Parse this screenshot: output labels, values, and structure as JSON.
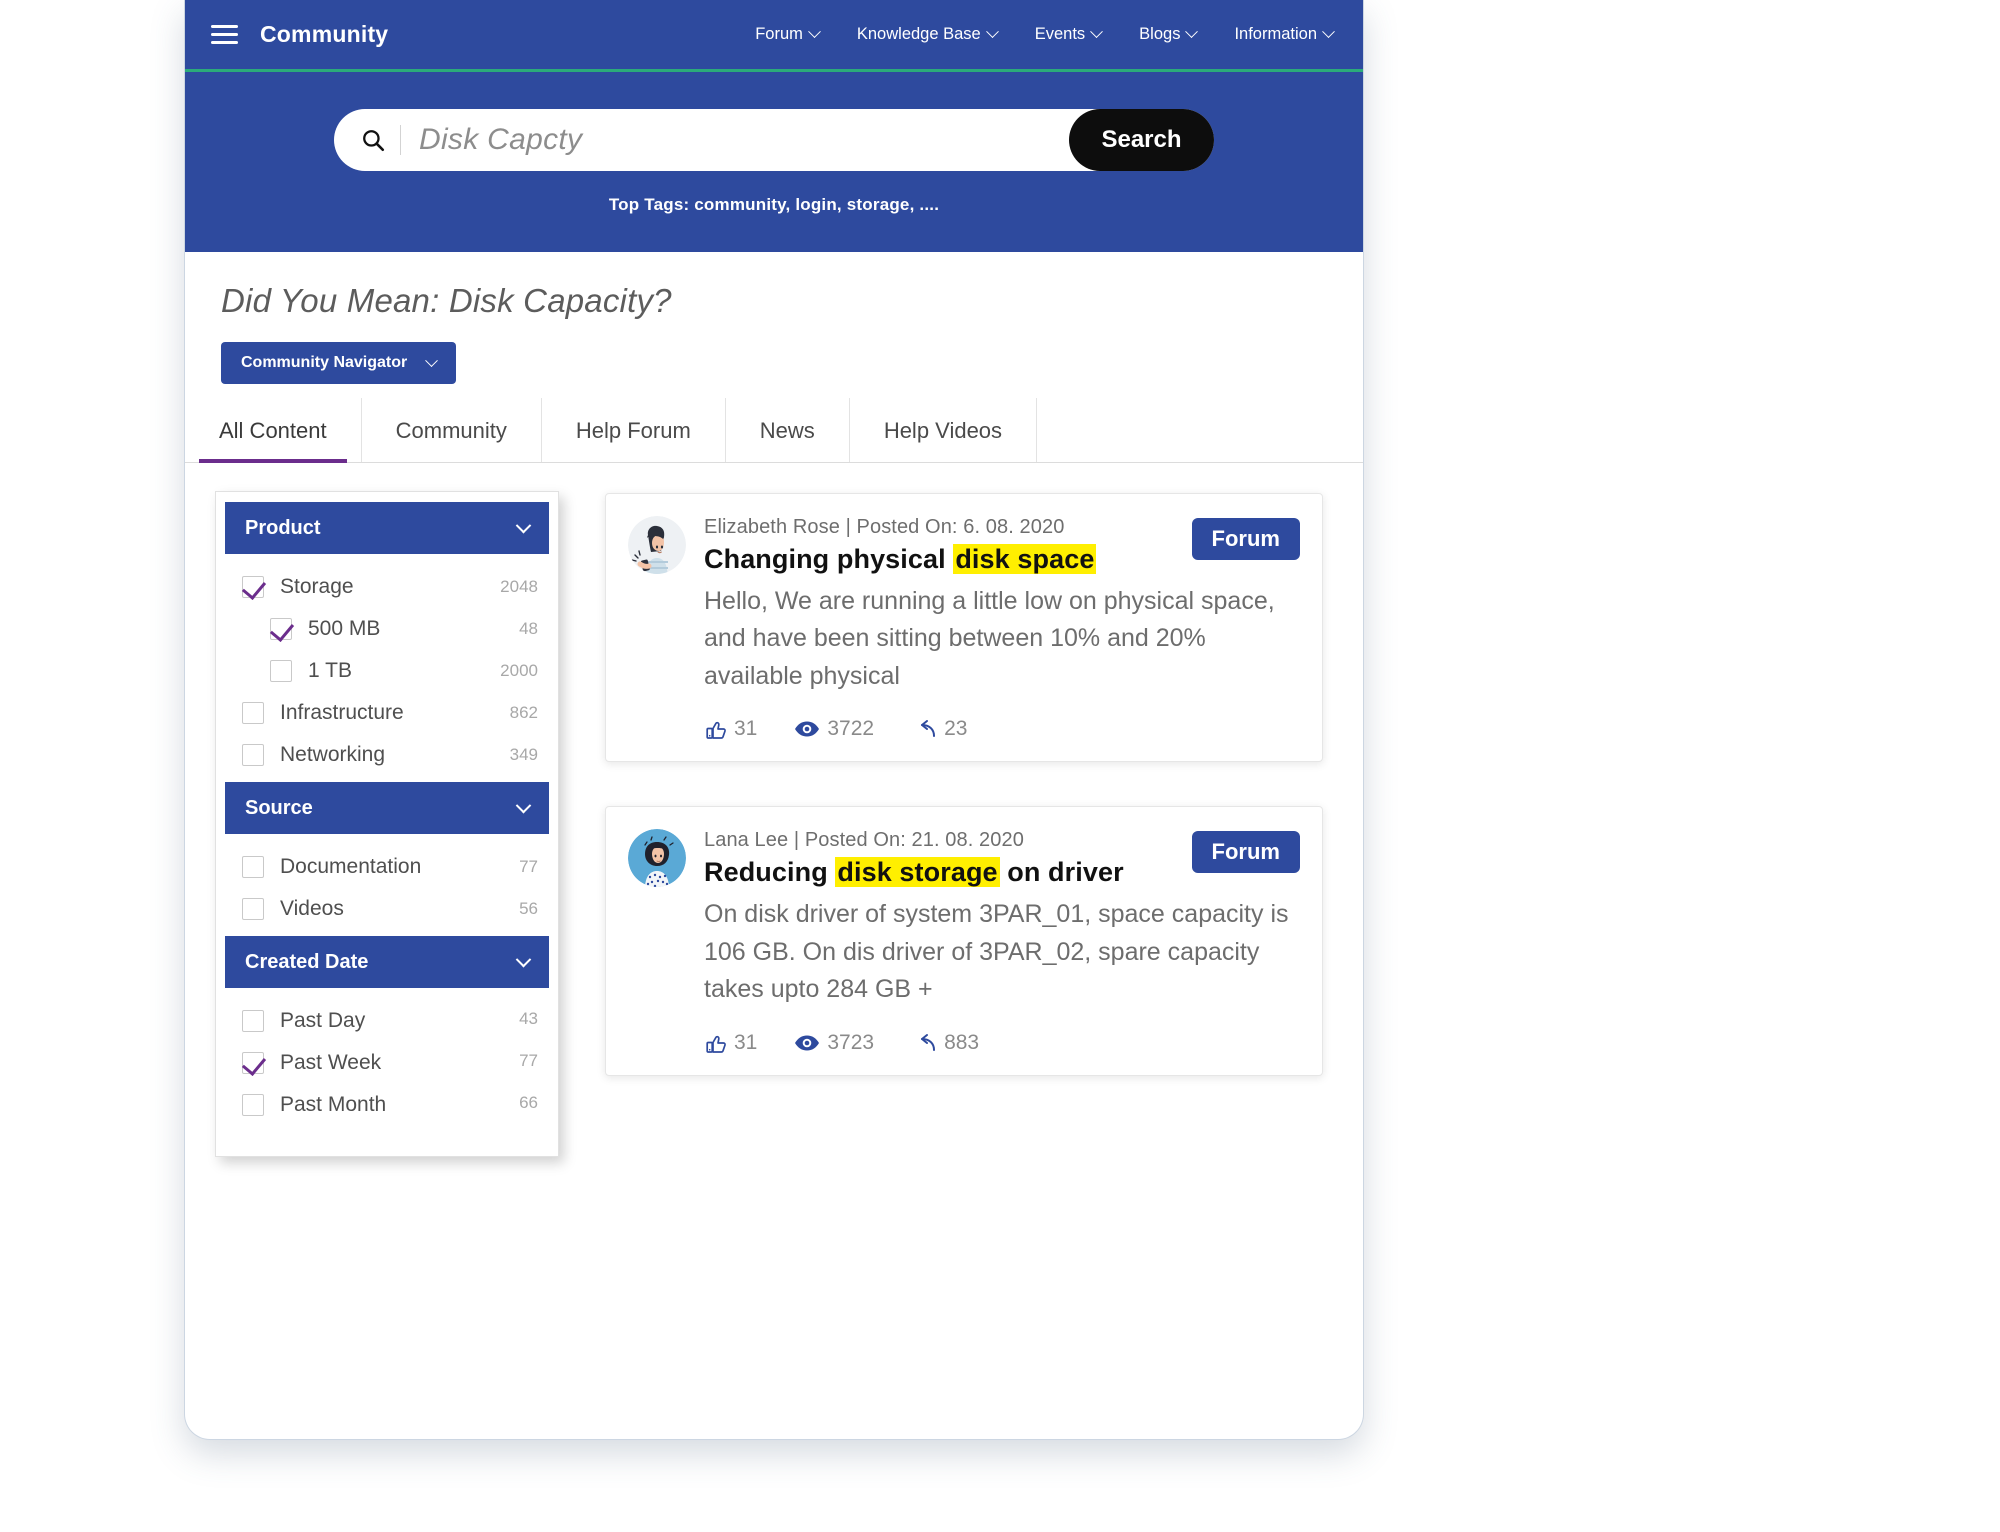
{
  "header": {
    "brand": "Community",
    "menu_icon": "hamburger-icon",
    "nav": [
      {
        "label": "Forum",
        "icon": "chevron-down-icon"
      },
      {
        "label": "Knowledge Base",
        "icon": "chevron-down-icon"
      },
      {
        "label": "Events",
        "icon": "chevron-down-icon"
      },
      {
        "label": "Blogs",
        "icon": "chevron-down-icon"
      },
      {
        "label": "Information",
        "icon": "chevron-down-icon"
      }
    ],
    "accent_color": "#2e4a9e",
    "underline_color": "#2bab7a"
  },
  "search": {
    "value": "Disk Capcty",
    "placeholder": "Disk Capcty",
    "icon": "search-icon",
    "button_label": "Search",
    "top_tags": "Top Tags: community, login, storage, ...."
  },
  "suggestion": {
    "did_you_mean": "Did You Mean: Disk Capacity?",
    "navigator_label": "Community Navigator",
    "navigator_icon": "chevron-down-icon"
  },
  "tabs": [
    {
      "label": "All Content",
      "active": true
    },
    {
      "label": "Community",
      "active": false
    },
    {
      "label": "Help Forum",
      "active": false
    },
    {
      "label": "News",
      "active": false
    },
    {
      "label": "Help Videos",
      "active": false
    }
  ],
  "active_tab_underline_color": "#6b2d8c",
  "facets": [
    {
      "title": "Product",
      "icon": "chevron-down-icon",
      "items": [
        {
          "label": "Storage",
          "count": "2048",
          "checked": true,
          "sub": false
        },
        {
          "label": "500 MB",
          "count": "48",
          "checked": true,
          "sub": true
        },
        {
          "label": "1 TB",
          "count": "2000",
          "checked": false,
          "sub": true
        },
        {
          "label": "Infrastructure",
          "count": "862",
          "checked": false,
          "sub": false
        },
        {
          "label": "Networking",
          "count": "349",
          "checked": false,
          "sub": false
        }
      ]
    },
    {
      "title": "Source",
      "icon": "chevron-down-icon",
      "items": [
        {
          "label": "Documentation",
          "count": "77",
          "checked": false,
          "sub": false
        },
        {
          "label": "Videos",
          "count": "56",
          "checked": false,
          "sub": false
        }
      ]
    },
    {
      "title": "Created Date",
      "icon": "chevron-down-icon",
      "items": [
        {
          "label": "Past Day",
          "count": "43",
          "checked": false,
          "sub": false
        },
        {
          "label": "Past Week",
          "count": "77",
          "checked": true,
          "sub": false
        },
        {
          "label": "Past Month",
          "count": "66",
          "checked": false,
          "sub": false
        }
      ]
    }
  ],
  "results": [
    {
      "author": "Elizabeth Rose",
      "meta": "Elizabeth Rose | Posted On: 6. 08. 2020",
      "title_before": "Changing physical ",
      "title_highlight": "disk space",
      "title_after": "",
      "snippet": "Hello, We are running a little low on physical space, and have been sitting between 10% and 20% available physical",
      "badge": "Forum",
      "likes": "31",
      "views": "3722",
      "replies": "23",
      "avatar": "woman-phone-avatar"
    },
    {
      "author": "Lana Lee",
      "meta": "Lana Lee | Posted On: 21. 08. 2020",
      "title_before": "Reducing ",
      "title_highlight": "disk storage",
      "title_after": " on driver",
      "snippet": "On disk driver of system 3PAR_01, space capacity is 106 GB. On dis driver of 3PAR_02, spare capacity takes upto 284 GB +",
      "badge": "Forum",
      "likes": "31",
      "views": "3723",
      "replies": "883",
      "avatar": "woman-curly-avatar"
    }
  ],
  "colors": {
    "brand_blue": "#2e4a9e",
    "highlight_yellow": "#ffef00",
    "purple": "#6b2d8c",
    "green": "#2bab7a",
    "search_button": "#0d0d0d"
  }
}
